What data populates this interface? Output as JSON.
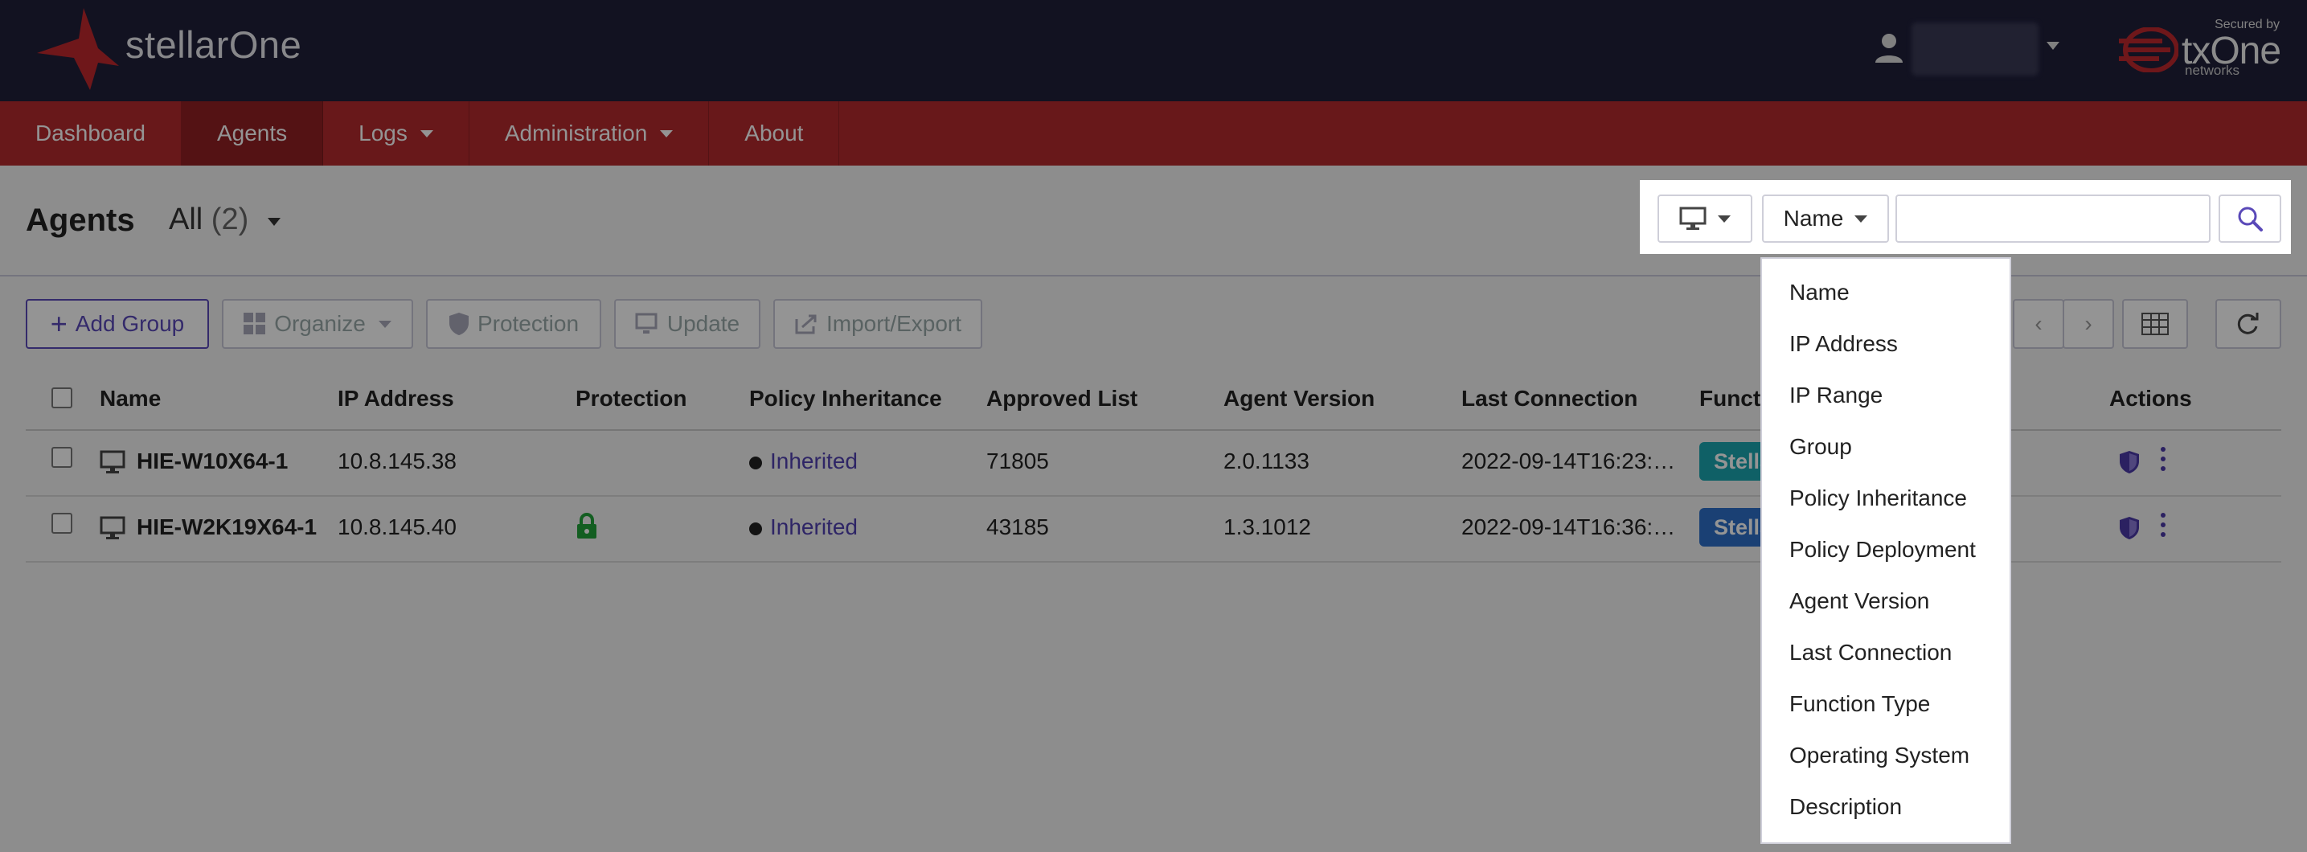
{
  "header": {
    "brand": "stellarOne",
    "secured_by": "Secured by",
    "vendor": "txOne",
    "vendor_sub": "networks"
  },
  "nav": {
    "items": [
      {
        "label": "Dashboard"
      },
      {
        "label": "Agents"
      },
      {
        "label": "Logs"
      },
      {
        "label": "Administration"
      },
      {
        "label": "About"
      }
    ]
  },
  "page": {
    "title": "Agents",
    "filter_label": "All",
    "filter_count": "(2)"
  },
  "toolbar": {
    "add_group": "Add Group",
    "organize": "Organize",
    "protection": "Protection",
    "update": "Update",
    "import_export": "Import/Export"
  },
  "table": {
    "columns": [
      "Name",
      "IP Address",
      "Protection",
      "Policy Inheritance",
      "Approved List",
      "Agent Version",
      "Last Connection",
      "Funct",
      "Actions"
    ],
    "rows": [
      {
        "name": "HIE-W10X64-1",
        "ip": "10.8.145.38",
        "protection": "",
        "policy": "Inherited",
        "approved": "71805",
        "version": "2.0.1133",
        "last": "2022-09-14T16:23:…",
        "func": "Stella"
      },
      {
        "name": "HIE-W2K19X64-1",
        "ip": "10.8.145.40",
        "protection": "locked",
        "policy": "Inherited",
        "approved": "43185",
        "version": "1.3.1012",
        "last": "2022-09-14T16:36:…",
        "func": "Stella"
      }
    ]
  },
  "search": {
    "field_selected": "Name",
    "input_value": "",
    "options": [
      "Name",
      "IP Address",
      "IP Range",
      "Group",
      "Policy Inheritance",
      "Policy Deployment",
      "Agent Version",
      "Last Connection",
      "Function Type",
      "Operating System",
      "Description"
    ]
  },
  "colors": {
    "topbar": "#1f1f3a",
    "nav": "#b32a2e",
    "accent": "#5a49b8",
    "pill_teal": "#1aa6b0",
    "pill_blue": "#2d6fc8"
  }
}
